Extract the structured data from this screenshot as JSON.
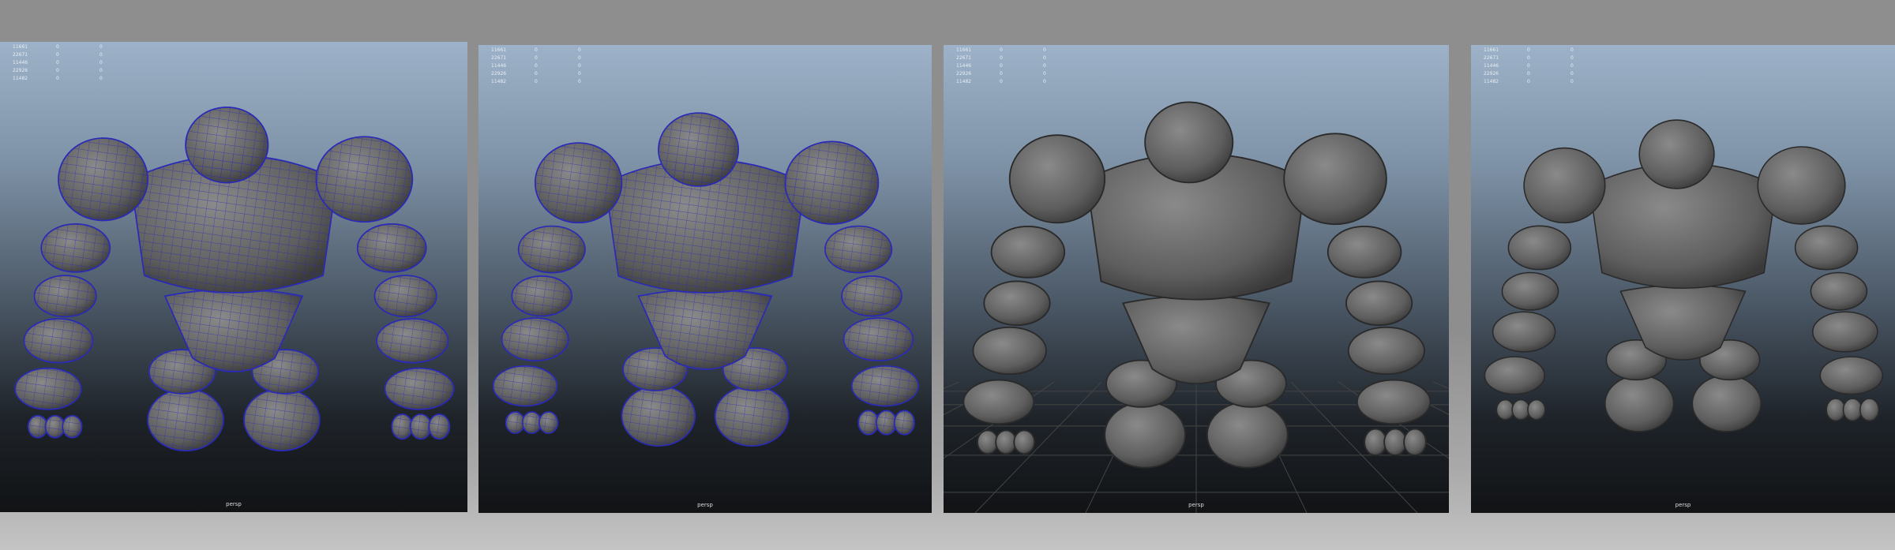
{
  "panels": [
    {
      "id": "wireframe-front",
      "shading": "wireframe-on-shaded",
      "camera": "persp",
      "stats": [
        [
          "11661",
          "0",
          "0"
        ],
        [
          "22671",
          "0",
          "0"
        ],
        [
          "11446",
          "0",
          "0"
        ],
        [
          "22926",
          "0",
          "0"
        ],
        [
          "11482",
          "0",
          "0"
        ]
      ]
    },
    {
      "id": "wireframe-back",
      "shading": "wireframe-on-shaded",
      "camera": "persp",
      "stats": [
        [
          "11661",
          "0",
          "0"
        ],
        [
          "22671",
          "0",
          "0"
        ],
        [
          "11446",
          "0",
          "0"
        ],
        [
          "22926",
          "0",
          "0"
        ],
        [
          "11482",
          "0",
          "0"
        ]
      ]
    },
    {
      "id": "shaded-front",
      "shading": "smooth-shaded",
      "camera": "persp",
      "stats": [
        [
          "11661",
          "0",
          "0"
        ],
        [
          "22671",
          "0",
          "0"
        ],
        [
          "11446",
          "0",
          "0"
        ],
        [
          "22926",
          "0",
          "0"
        ],
        [
          "11482",
          "0",
          "0"
        ]
      ]
    },
    {
      "id": "shaded-back",
      "shading": "smooth-shaded",
      "camera": "persp",
      "stats": [
        [
          "11661",
          "0",
          "0"
        ],
        [
          "22671",
          "0",
          "0"
        ],
        [
          "11446",
          "0",
          "0"
        ],
        [
          "22926",
          "0",
          "0"
        ],
        [
          "11482",
          "0",
          "0"
        ]
      ]
    }
  ],
  "colors": {
    "wire": "#2a2ab8",
    "mesh": "#6e6e6e",
    "viewport_top": "#9db2c8",
    "viewport_bottom": "#111315"
  }
}
